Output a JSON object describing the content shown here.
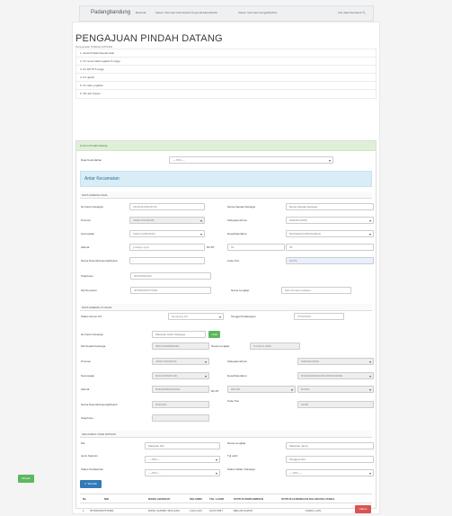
{
  "navbar": {
    "brand": "Padangbandung",
    "items": [
      "Beranda",
      "Sistem Informasi Administrasi Kependudukan(SIAK)",
      "Sistem Informasi Geografis(SIG)"
    ],
    "search": "Cari data Penduduk"
  },
  "page": {
    "title": "PENGAJUAN PINDAH DATANG",
    "subtitle": "Persyaratan PINDAH DATANG"
  },
  "requirements": [
    "1. Surat Pindah Daerah Asal",
    "2. FC surat nikah legalisir 5 anggi",
    "3. FC EKTP 5 anggi",
    "4. FC ijazah",
    "5. FC akte yugalise",
    "6. NK asli Tujuan"
  ],
  "form": {
    "panel_title": "Form Pindah Datang",
    "jenis_label": "Data Kepindahan",
    "jenis_value": "----Pilih----",
    "alert": "Antar Kecamatan",
    "asal": {
      "header": "DATA DAERAH ASAL",
      "no_kk_label": "No Kartu Keluarga",
      "no_kk_value": "3323011234045718",
      "nama_kk_label": "Nama Kepala Keluarga",
      "nama_kk_placeholder": "Nama Kepala Keluarga",
      "prov_label": "Provinsi",
      "prov_value": "JAWA TIMUR(35)",
      "kab_label": "Kabupaten/Kota",
      "kab_value": "GRESIK(3525)",
      "kec_label": "Kecamatan",
      "kec_value": "SIDAYU(3525130)",
      "desa_label": "Desa/Kelurahan",
      "desa_value": "BUNDERAN(3525130011)",
      "alamat_label": "Alamat",
      "alamat_value": "jl.sidayu raya",
      "rt_label": "Rt/ RT",
      "rt_value": "02",
      "rw_value": "05",
      "dusun_label": "Nama Dusun/Kampung/Dukuh",
      "dusun_value": "-",
      "pos_label": "Kode Pos",
      "pos_value": "62173",
      "tel_label": "Telephone",
      "tel_value": "081235951182",
      "nik_label": "Nik Pemohon",
      "nik_value": "3578152307970001",
      "nama_label": "Nama Lengkap",
      "nama_value": "Moh.ahmad mauliana"
    },
    "tujuan": {
      "header": "DATA DAERAH TUJUAN",
      "status_kk_label": "Status Nomor KK",
      "status_kk_value": "Numpang KK",
      "tgl_label": "Tanggal Kedatangan",
      "tgl_value": "07/03/2019",
      "no_kk_label": "No Kartu Keluarga",
      "no_kk_placeholder": "Masukan Kartu Keluarga",
      "cek_label": "Cek",
      "nik_kk_label": "Nik Kepala Keluarga",
      "nik_kk_value": "3507123006890001",
      "nama_label": "Nama Lengkap",
      "nama_value": "SYAIFUL ARIS",
      "prov_label": "Provinsi",
      "prov_value": "JAWA TIMUR(35)",
      "kab_label": "Kabupaten/Kota",
      "kab_value": "GRESIK(3525)",
      "kec_label": "Kecamatan",
      "kec_value": "DUKUN(3525140)",
      "desa_label": "Desa/Kelurahan",
      "desa_value": "PADANGBANDUNG(3525140009)",
      "alamat_label": "Alamat",
      "alamat_value": "PADANGBANDUNG",
      "rt_label": "Rt/ RT",
      "rt_value": "RW:001",
      "rw_value": "RT:001",
      "dusun_label": "Nama Dusun/Kampung/Dukuh",
      "dusun_value": "PADANG",
      "pos_label": "Kode Pos",
      "pos_value": "61155",
      "tel_label": "Telephone",
      "tel_value": "-"
    },
    "keluarga": {
      "header": "KELUARGA YANG DATANG",
      "nik_label": "Nik",
      "nik_placeholder": "Masukan Nik",
      "nama_label": "Nama Lengkap",
      "nama_placeholder": "Masukan nama",
      "jk_label": "Jenis Kelamin",
      "jk_value": "----Pilih----",
      "tgl_label": "Tgl Lahir",
      "tgl_placeholder": "Tanggal Lahir",
      "status_kawin_label": "Status Perkawinan",
      "status_kawin_value": "----Pilih----",
      "status_klg_label": "Status Dalam Keluarga",
      "status_klg_value": "----Pilih----",
      "add_label": "Tambah"
    },
    "table": {
      "headers": [
        "No",
        "NIK",
        "NAMA LENGKAP",
        "KELAMIN",
        "TGL LAHIR",
        "STATUS PERKAWINAN",
        "STATUS HUBUNGAN DALAM KELUARGA"
      ],
      "row": [
        "1",
        "3578152307970001",
        "RIZQI SLAMET MULIANA",
        "LAKI-LAKI",
        "21/07/1997",
        "BELUM KAWIN",
        "FAMILI LAIN"
      ],
      "delete_label": "Hapus"
    },
    "submit_label": "Simpan"
  },
  "colors": {
    "accent_green": "#5cb85c",
    "accent_blue": "#337ab7",
    "danger": "#d9534f",
    "alert_bg": "#d9edf7"
  }
}
